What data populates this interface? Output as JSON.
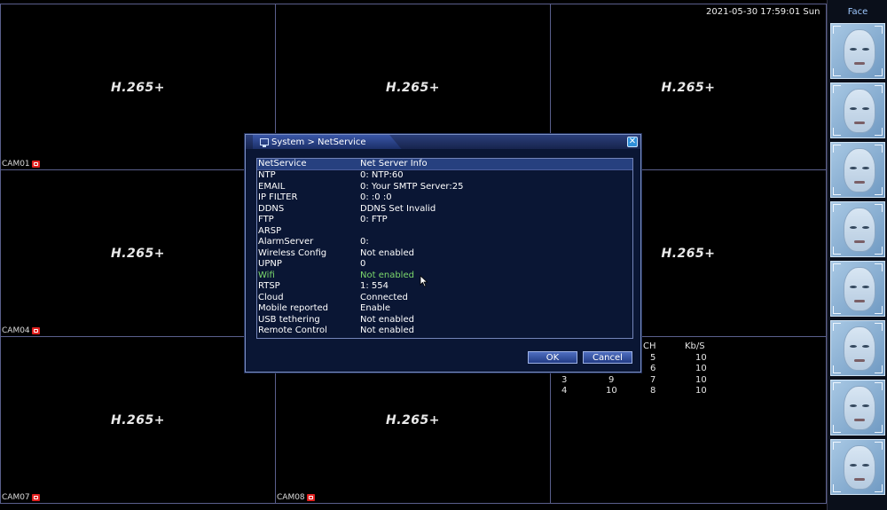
{
  "datetime": "2021-05-30 17:59:01 Sun",
  "codec_text": "H.265+",
  "cells": [
    {
      "codec": "H.265+",
      "cam": "CAM01"
    },
    {
      "codec": "H.265+",
      "cam": ""
    },
    {
      "codec": "H.265+",
      "cam": ""
    },
    {
      "codec": "H.265+",
      "cam": "CAM04"
    },
    {
      "codec": "",
      "cam": ""
    },
    {
      "codec": "H.265+",
      "cam": ""
    },
    {
      "codec": "H.265+",
      "cam": "CAM07"
    },
    {
      "codec": "H.265+",
      "cam": "CAM08"
    },
    {
      "codec": "",
      "cam": ""
    }
  ],
  "face_panel": {
    "title": "Face",
    "thumbnail_count": 8,
    "icon": "face-thumbnail-icon"
  },
  "stats": {
    "headers": {
      "ch": "CH",
      "kbs": "Kb/S"
    },
    "rows": [
      {
        "a": "",
        "b": "",
        "ch": "5",
        "kbs": "10"
      },
      {
        "a": "",
        "b": "",
        "ch": "6",
        "kbs": "10"
      },
      {
        "a": "3",
        "b": "9",
        "ch": "7",
        "kbs": "10"
      },
      {
        "a": "4",
        "b": "10",
        "ch": "8",
        "kbs": "10"
      }
    ]
  },
  "dialog": {
    "title": "System > NetService",
    "close_icon": "close-icon",
    "header": {
      "col1": "NetService",
      "col2": "Net Server Info"
    },
    "rows": [
      {
        "name": "NTP",
        "info": "0: NTP:60",
        "highlight": false
      },
      {
        "name": "EMAIL",
        "info": "0: Your SMTP Server:25",
        "highlight": false
      },
      {
        "name": "IP FILTER",
        "info": "0: :0 :0",
        "highlight": false
      },
      {
        "name": "DDNS",
        "info": "DDNS Set Invalid",
        "highlight": false
      },
      {
        "name": "FTP",
        "info": "0: FTP",
        "highlight": false
      },
      {
        "name": "ARSP",
        "info": "",
        "highlight": false
      },
      {
        "name": "AlarmServer",
        "info": "0:",
        "highlight": false
      },
      {
        "name": "Wireless Config",
        "info": "Not enabled",
        "highlight": false
      },
      {
        "name": "UPNP",
        "info": "0",
        "highlight": false
      },
      {
        "name": "Wifi",
        "info": "Not enabled",
        "highlight": true
      },
      {
        "name": "RTSP",
        "info": "1: 554",
        "highlight": false
      },
      {
        "name": "Cloud",
        "info": "Connected",
        "highlight": false
      },
      {
        "name": "Mobile reported",
        "info": "Enable",
        "highlight": false
      },
      {
        "name": "USB tethering",
        "info": "Not enabled",
        "highlight": false
      },
      {
        "name": "Remote Control",
        "info": "Not enabled",
        "highlight": false
      }
    ],
    "ok_label": "OK",
    "cancel_label": "Cancel"
  },
  "colors": {
    "accent": "#2b3f7a",
    "highlight": "#7cd96c",
    "rec": "#e0201f"
  }
}
